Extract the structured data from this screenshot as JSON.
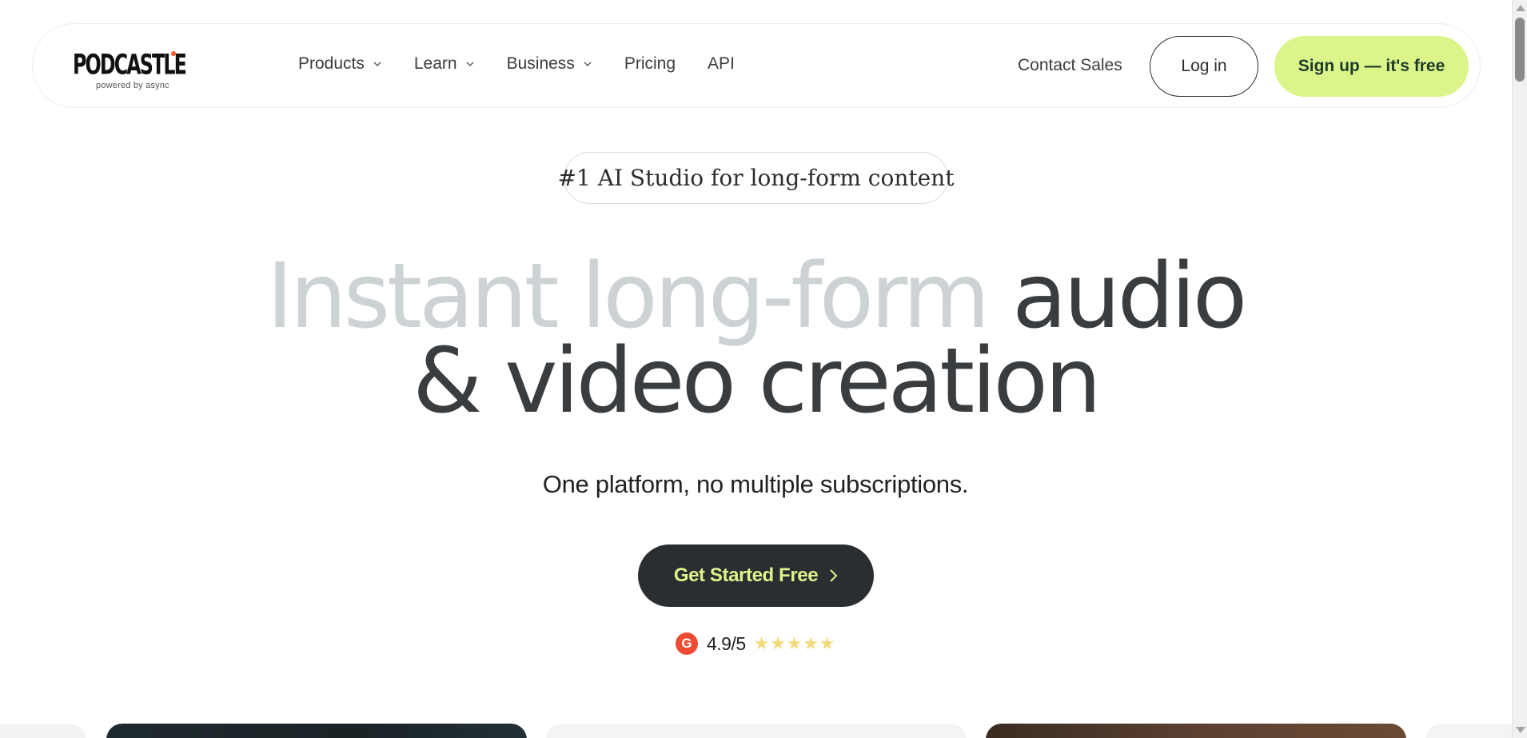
{
  "logo": {
    "wordmark": "PODCASTLE",
    "tagline": "powered by async",
    "dot_color": "#ff5a2c"
  },
  "nav": {
    "items": [
      {
        "label": "Products",
        "has_dropdown": true
      },
      {
        "label": "Learn",
        "has_dropdown": true
      },
      {
        "label": "Business",
        "has_dropdown": true
      },
      {
        "label": "Pricing",
        "has_dropdown": false
      },
      {
        "label": "API",
        "has_dropdown": false
      }
    ],
    "contact_sales": "Contact Sales",
    "login": "Log in",
    "signup": "Sign up — it's free"
  },
  "hero": {
    "badge": "#1 AI Studio for long-form content",
    "headline_light": "Instant long-form",
    "headline_dark_1": "audio",
    "headline_dark_2": "& video creation",
    "subline": "One platform, no multiple subscriptions.",
    "cta": "Get Started Free",
    "rating_logo": "G",
    "rating": "4.9/5",
    "stars": 5
  },
  "colors": {
    "accent_lime": "#dbf58b",
    "dark": "#2b2e30",
    "headline_light": "#cdd2d5",
    "g2_red": "#ef4a32",
    "star": "#f3d97a"
  }
}
